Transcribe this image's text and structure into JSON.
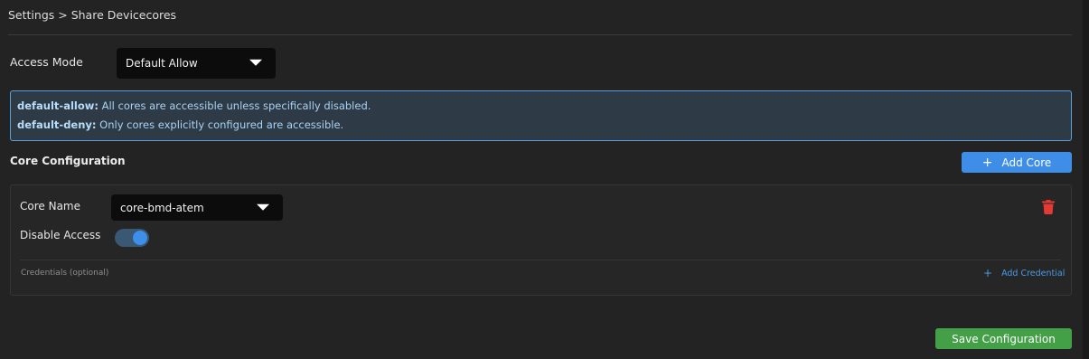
{
  "breadcrumb": "Settings > Share Devicecores",
  "access_mode": {
    "label": "Access Mode",
    "selected": "Default Allow"
  },
  "info": {
    "allow_term": "default-allow:",
    "allow_text": " All cores are accessible unless specifically disabled.",
    "deny_term": "default-deny:",
    "deny_text": " Only cores explicitly configured are accessible."
  },
  "core_section": {
    "title": "Core Configuration",
    "add_button": "Add Core"
  },
  "core": {
    "name_label": "Core Name",
    "name_value": "core-bmd-atem",
    "disable_label": "Disable Access",
    "disable_on": true,
    "credentials_label": "Credentials (optional)",
    "add_credential": "Add Credential"
  },
  "save_button": "Save Configuration",
  "colors": {
    "accent": "#3e8ee8",
    "save": "#43a047",
    "delete": "#e53935",
    "info_border": "#5aa0d8"
  }
}
